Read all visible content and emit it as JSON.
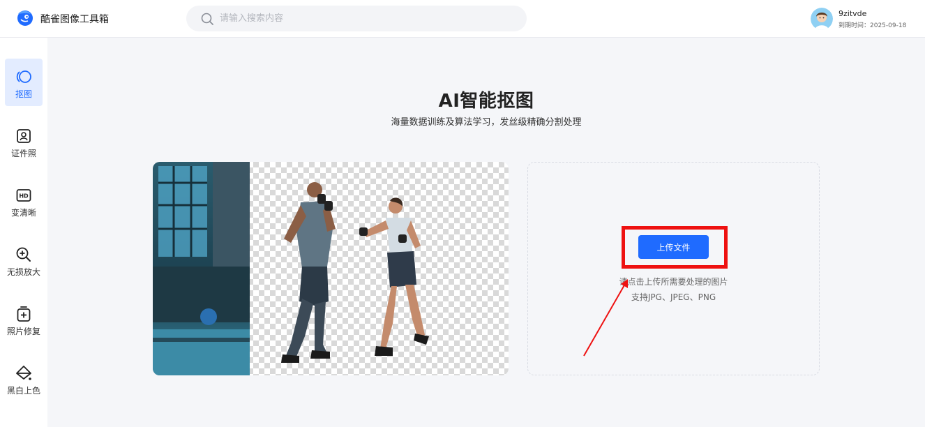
{
  "header": {
    "app_title": "酷雀图像工具箱",
    "search_placeholder": "请输入搜索内容",
    "username": "9zitvde",
    "expiry": "到期时间：2025-09-18"
  },
  "sidebar": {
    "items": [
      {
        "label": "抠图",
        "icon": "cutout-icon",
        "active": true
      },
      {
        "label": "证件照",
        "icon": "id-photo-icon"
      },
      {
        "label": "变清晰",
        "icon": "hd-icon"
      },
      {
        "label": "无损放大",
        "icon": "zoom-in-icon"
      },
      {
        "label": "照片修复",
        "icon": "photo-repair-icon"
      },
      {
        "label": "黑白上色",
        "icon": "colorize-icon"
      }
    ]
  },
  "main": {
    "title": "AI智能抠图",
    "subtitle": "海量数据训练及算法学习，发丝级精确分割处理"
  },
  "upload": {
    "button_label": "上传文件",
    "hint": "请点击上传所需要处理的图片",
    "formats": "支持JPG、JPEG、PNG"
  },
  "colors": {
    "accent": "#1f6bff",
    "highlight": "#ee1111",
    "background": "#f5f6f9"
  }
}
